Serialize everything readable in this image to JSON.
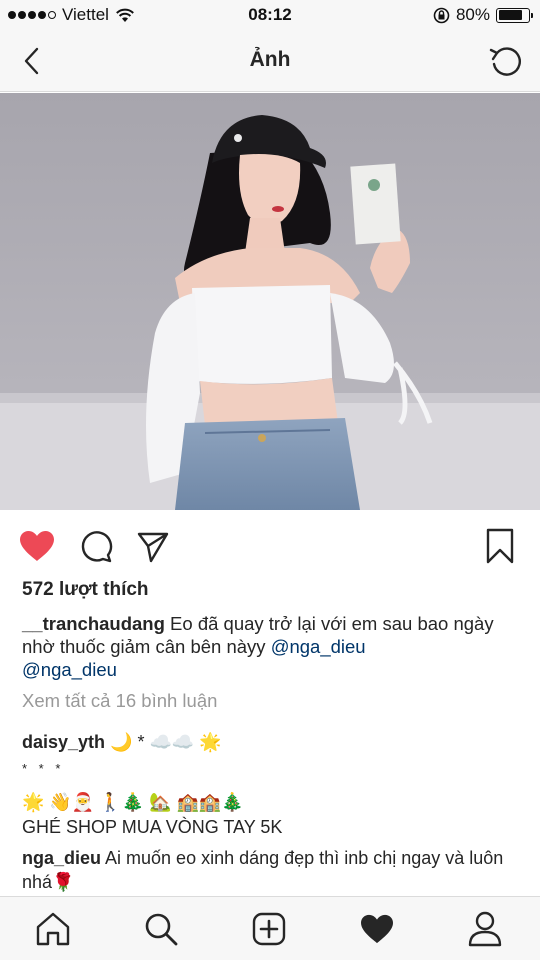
{
  "status": {
    "carrier": "Viettel",
    "time": "08:12",
    "battery": "80%",
    "battery_level": 0.8,
    "signal_bars": 4
  },
  "nav": {
    "title": "Ảnh",
    "back_icon": "chevron-left-icon",
    "refresh_icon": "refresh-icon"
  },
  "post": {
    "likes": "572 lượt thích",
    "caption": {
      "username": "__tranchaudang",
      "text": " Eo đã quay trở lại với em sau bao ngày nhờ thuốc giảm cân bên nàyy ",
      "mention1": "@nga_dieu",
      "mention2": "@nga_dieu"
    },
    "view_comments": "Xem tất cả 16 bình luận",
    "comments": [
      {
        "username": "daisy_yth",
        "text": " 🌙 * ☁️☁️ 🌟"
      },
      {
        "text": "* * *"
      },
      {
        "text": "🌟 👋🎅 🚶🎄 🏡 🏫🏫🎄"
      },
      {
        "text": "GHÉ SHOP MUA VÒNG TAY 5K"
      },
      {
        "username": "nga_dieu",
        "text": " Ai muốn eo xinh dáng đẹp thì inb chị ngay và luôn nhá🌹"
      }
    ]
  },
  "colors": {
    "like_red": "#ed4956",
    "mention_blue": "#003569",
    "muted_gray": "#999999",
    "bar_bg": "#f7f7f7"
  }
}
